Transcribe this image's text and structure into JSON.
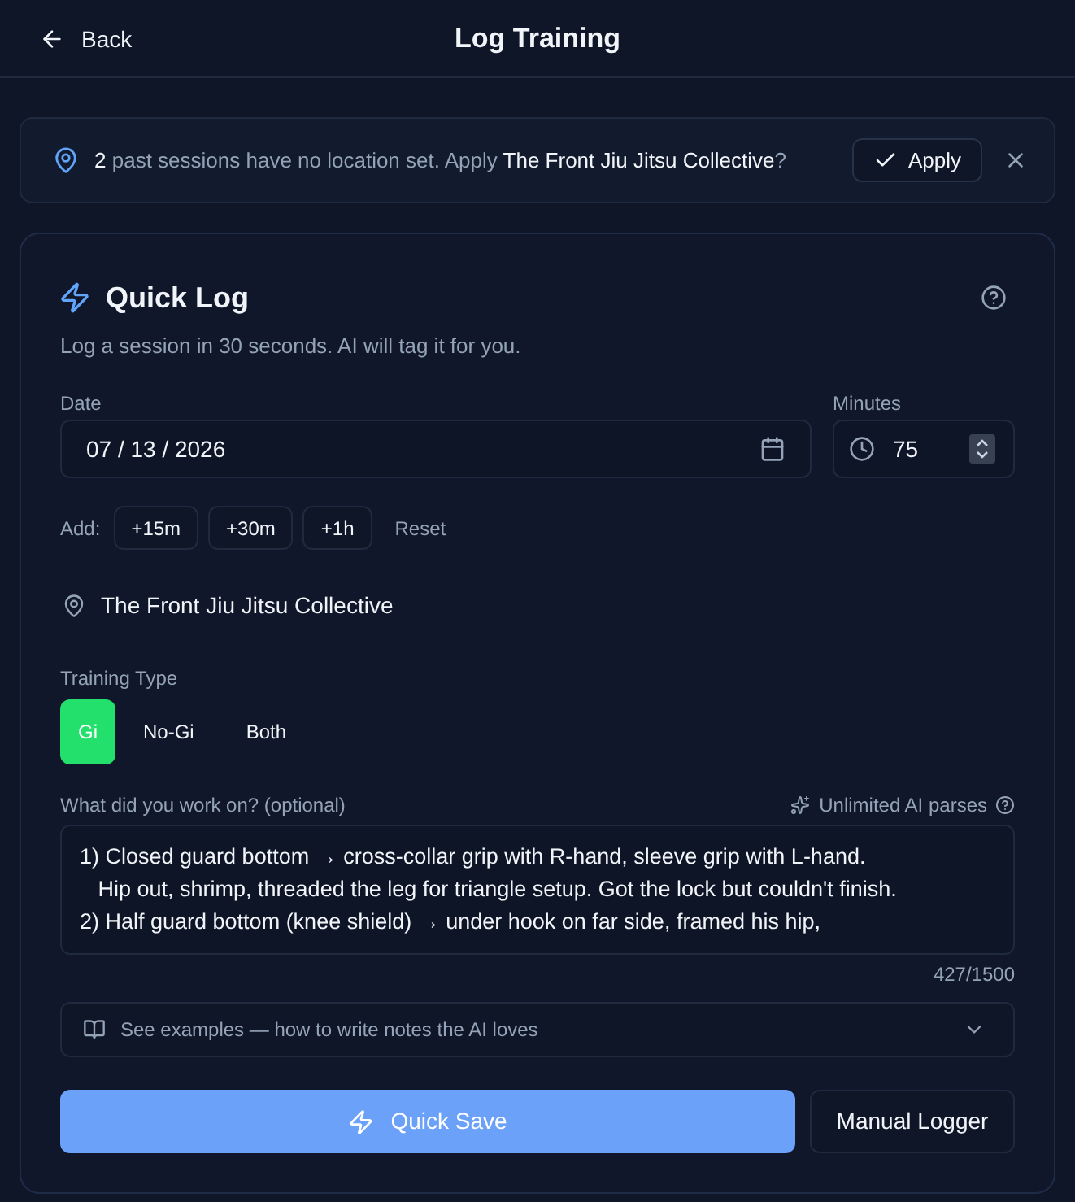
{
  "header": {
    "back": "Back",
    "title": "Log Training"
  },
  "banner": {
    "count": "2",
    "message": "past sessions have no location set. Apply",
    "location": "The Front Jiu Jitsu Collective",
    "suffix": "?",
    "action": "Apply"
  },
  "quick_log": {
    "title": "Quick Log",
    "subtitle": "Log a session in 30 seconds. AI will tag it for you.",
    "date": {
      "label": "Date",
      "value": "07 / 13 / 2026"
    },
    "minutes": {
      "label": "Minutes",
      "value": "75"
    },
    "add": {
      "label": "Add:",
      "buttons": [
        "+15m",
        "+30m",
        "+1h"
      ],
      "reset": "Reset"
    },
    "location": "The Front Jiu Jitsu Collective",
    "training_type": {
      "label": "Training Type",
      "options": [
        {
          "label": "Gi",
          "selected": true
        },
        {
          "label": "No-Gi",
          "selected": false
        },
        {
          "label": "Both",
          "selected": false
        }
      ]
    },
    "notes": {
      "label": "What did you work on? (optional)",
      "ai_badge": "Unlimited AI parses",
      "value": "1) Closed guard bottom → cross-collar grip with R-hand, sleeve grip with L-hand.\n   Hip out, shrimp, threaded the leg for triangle setup. Got the lock but couldn't finish.\n2) Half guard bottom (knee shield) → under hook on far side, framed his hip,",
      "counter": "427/1500"
    },
    "examples": {
      "label": "See examples — how to write notes the AI loves",
      "expanded": false
    },
    "actions": {
      "primary": "Quick Save",
      "secondary": "Manual Logger"
    }
  }
}
